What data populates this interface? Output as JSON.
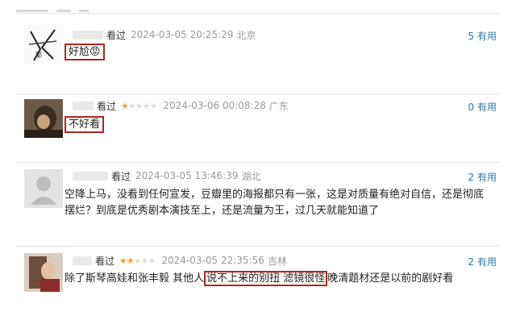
{
  "comments": [
    {
      "watched": "看过",
      "time": "2024-03-05 20:25:29",
      "location": "北京",
      "useful_count": "5",
      "useful_label": "有用",
      "content": "好尬😡",
      "rating": 0
    },
    {
      "watched": "看过",
      "time": "2024-03-06 00:08:28",
      "location": "广东",
      "useful_count": "0",
      "useful_label": "有用",
      "content": "不好看",
      "rating": 1
    },
    {
      "watched": "看过",
      "time": "2024-03-05 13:46:39",
      "location": "湖北",
      "useful_count": "2",
      "useful_label": "有用",
      "content": "空降上马，没看到任何宣发，豆瓣里的海报都只有一张，这是对质量有绝对自信，还是彻底摆烂？到底是优秀剧本演技至上，还是流量为王，过几天就能知道了",
      "rating": 0
    },
    {
      "watched": "看过",
      "time": "2024-03-05 22:35:56",
      "location": "吉林",
      "useful_count": "2",
      "useful_label": "有用",
      "content_before": "除了斯琴高娃和张丰毅 其他人",
      "content_highlight": "说不上来的别扭 滤镜很怪",
      "content_after": "晚清题材还是以前的剧好看",
      "rating": 2
    }
  ],
  "colors": {
    "highlight_border": "#b32424",
    "useful_link": "#3377aa",
    "star_on": "#f2a531",
    "star_off": "#dddddd",
    "meta_gray": "#999999"
  },
  "icons": {
    "star": "★"
  }
}
